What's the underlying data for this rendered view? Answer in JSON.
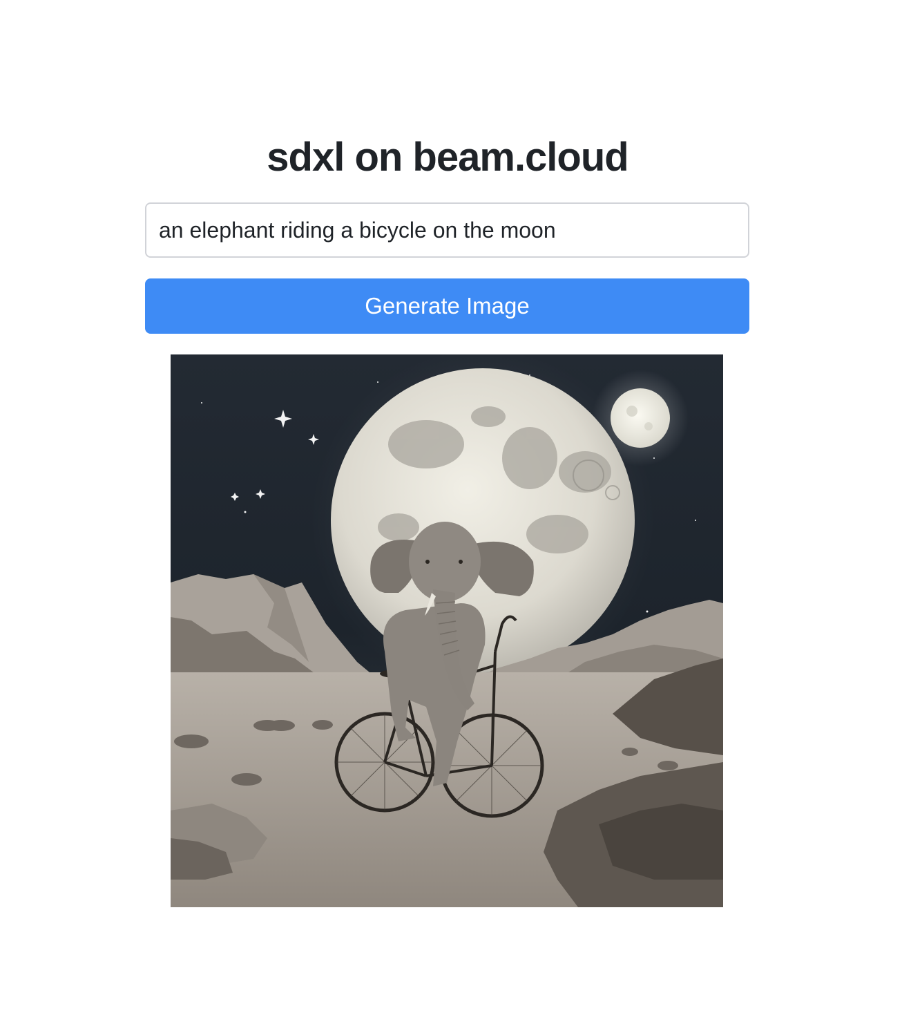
{
  "header": {
    "title": "sdxl on beam.cloud"
  },
  "prompt": {
    "value": "an elephant riding a bicycle on the moon"
  },
  "actions": {
    "generate_label": "Generate Image"
  },
  "result": {
    "icon": "generated-image"
  }
}
